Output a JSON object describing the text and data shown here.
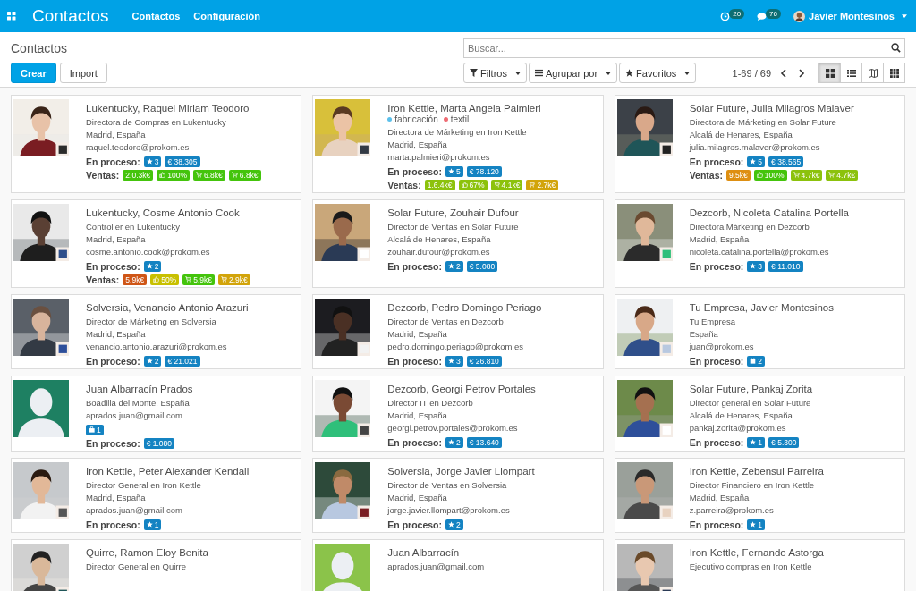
{
  "top_bar": {
    "app_title": "Contactos",
    "menu": [
      "Contactos",
      "Configuración"
    ],
    "activity_count": "20",
    "messages_count": "76",
    "user_name": "Javier Montesinos"
  },
  "control_panel": {
    "breadcrumb": "Contactos",
    "search": {
      "placeholder": "Buscar..."
    },
    "create_button": "Crear",
    "import_button": "Import",
    "filters": [
      {
        "kind": "filter",
        "label": "Filtros"
      },
      {
        "kind": "group",
        "label": "Agrupar por"
      },
      {
        "kind": "favorites",
        "label": "Favoritos"
      }
    ],
    "pager": "1-69 / 69",
    "views": [
      {
        "kind": "kanban",
        "selected": true
      },
      {
        "kind": "list",
        "selected": false
      },
      {
        "kind": "map",
        "selected": false
      },
      {
        "kind": "grid",
        "selected": false
      }
    ]
  },
  "cards": [
    {
      "photo": {
        "kind": "picture"
      },
      "name": "Lukentucky, Raquel Miriam Teodoro",
      "lines": [
        "Directora de Compras en Lukentucky",
        "Madrid, España",
        "raquel.teodoro@prokom.es"
      ],
      "pipeline_label": "En proceso:",
      "pipeline": [
        {
          "kind": "rating",
          "text": "3"
        },
        {
          "kind": "amount",
          "text": "€ 38.305"
        }
      ],
      "sales_label": "Ventas:",
      "sales": [
        {
          "kind": "total",
          "text": "2.0.3k€",
          "color": "#44c40c"
        },
        {
          "kind": "win_rate",
          "text": "100%",
          "color": "#44c40c"
        },
        {
          "kind": "orders",
          "text": "6.8k€",
          "color": "#44c40c"
        },
        {
          "kind": "orders",
          "text": "6.8k€",
          "color": "#44c40c"
        }
      ]
    },
    {
      "photo": {
        "kind": "picture"
      },
      "name": "Iron Kettle, Marta Angela Palmieri",
      "tags": [
        {
          "text": "fabricación",
          "color": "#5bc0eb"
        },
        {
          "text": "textil",
          "color": "#ef6b73"
        }
      ],
      "lines": [
        "Directora de Márketing en Iron Kettle",
        "Madrid, España",
        "marta.palmieri@prokom.es"
      ],
      "pipeline_label": "En proceso:",
      "pipeline": [
        {
          "kind": "rating",
          "text": "5"
        },
        {
          "kind": "amount",
          "text": "€ 78.120"
        }
      ],
      "sales_label": "Ventas:",
      "sales": [
        {
          "kind": "total",
          "text": "1.6.4k€",
          "color": "#8cc20c"
        },
        {
          "kind": "win_rate",
          "text": "67%",
          "color": "#8cc20c"
        },
        {
          "kind": "orders",
          "text": "4.1k€",
          "color": "#8cc20c"
        },
        {
          "kind": "orders",
          "text": "2.7k€",
          "color": "#d2a40a"
        }
      ]
    },
    {
      "photo": {
        "kind": "picture"
      },
      "name": "Solar Future, Julia Milagros Malaver",
      "lines": [
        "Directora de Márketing en Solar Future",
        "Alcalá de Henares, España",
        "julia.milagros.malaver@prokom.es"
      ],
      "pipeline_label": "En proceso:",
      "pipeline": [
        {
          "kind": "rating",
          "text": "5"
        },
        {
          "kind": "amount",
          "text": "€ 38.565"
        }
      ],
      "sales_label": "Ventas:",
      "sales": [
        {
          "kind": "total",
          "text": "9.5k€",
          "color": "#de8f12"
        },
        {
          "kind": "win_rate",
          "text": "100%",
          "color": "#44c40c"
        },
        {
          "kind": "orders",
          "text": "4.7k€",
          "color": "#8cc20c"
        },
        {
          "kind": "orders",
          "text": "4.7k€",
          "color": "#8cc20c"
        }
      ]
    },
    {
      "photo": {
        "kind": "picture"
      },
      "name": "Lukentucky, Cosme Antonio Cook",
      "lines": [
        "Controller en Lukentucky",
        "Madrid, España",
        "cosme.antonio.cook@prokom.es"
      ],
      "pipeline_label": "En proceso:",
      "pipeline": [
        {
          "kind": "rating",
          "text": "2"
        }
      ],
      "sales_label": "Ventas:",
      "sales": [
        {
          "kind": "total",
          "text": "5.9k€",
          "color": "#cf5516"
        },
        {
          "kind": "win_rate",
          "text": "50%",
          "color": "#c8c000"
        },
        {
          "kind": "orders",
          "text": "5.9k€",
          "color": "#44c40c"
        },
        {
          "kind": "orders",
          "text": "2.9k€",
          "color": "#d2a40a"
        }
      ]
    },
    {
      "photo": {
        "kind": "picture"
      },
      "name": "Solar Future, Zouhair Dufour",
      "lines": [
        "Director de Ventas en Solar Future",
        "Alcalá de Henares, España",
        "zouhair.dufour@prokom.es"
      ],
      "pipeline_label": "En proceso:",
      "pipeline": [
        {
          "kind": "rating",
          "text": "2"
        },
        {
          "kind": "amount",
          "text": "€ 5.080"
        }
      ]
    },
    {
      "photo": {
        "kind": "picture"
      },
      "name": "Dezcorb, Nicoleta Catalina Portella",
      "lines": [
        "Directora Márketing en Dezcorb",
        "Madrid, España",
        "nicoleta.catalina.portella@prokom.es"
      ],
      "pipeline_label": "En proceso:",
      "pipeline": [
        {
          "kind": "rating",
          "text": "3"
        },
        {
          "kind": "amount",
          "text": "€ 11.010"
        }
      ]
    },
    {
      "photo": {
        "kind": "picture"
      },
      "name": "Solversia, Venancio Antonio Arazuri",
      "lines": [
        "Director de Márketing en Solversia",
        "Madrid, España",
        "venancio.antonio.arazuri@prokom.es"
      ],
      "pipeline_label": "En proceso:",
      "pipeline": [
        {
          "kind": "rating",
          "text": "2"
        },
        {
          "kind": "amount",
          "text": "€ 21.021"
        }
      ]
    },
    {
      "photo": {
        "kind": "picture"
      },
      "name": "Dezcorb, Pedro Domingo Periago",
      "lines": [
        "Director de Ventas en Dezcorb",
        "Madrid, España",
        "pedro.domingo.periago@prokom.es"
      ],
      "pipeline_label": "En proceso:",
      "pipeline": [
        {
          "kind": "rating",
          "text": "3"
        },
        {
          "kind": "amount",
          "text": "€ 26.810"
        }
      ]
    },
    {
      "photo": {
        "kind": "picture"
      },
      "name": "Tu Empresa, Javier Montesinos",
      "lines": [
        "Tu Empresa",
        "España",
        "juan@prokom.es"
      ],
      "pipeline_label": "En proceso:",
      "pipeline": [
        {
          "kind": "meetings",
          "text": "2"
        }
      ]
    },
    {
      "photo": {
        "kind": "placeholder",
        "color": "#1e8062"
      },
      "name": "Juan Albarracín Prados",
      "lines": [
        "Boadilla del Monte, España",
        "aprados.juan@gmail.com"
      ],
      "extra": [
        {
          "kind": "opportunities",
          "text": "1"
        }
      ],
      "pipeline_label": "En proceso:",
      "pipeline": [
        {
          "kind": "amount",
          "text": "€ 1.080"
        }
      ]
    },
    {
      "photo": {
        "kind": "picture"
      },
      "name": "Dezcorb, Georgi Petrov Portales",
      "lines": [
        "Director IT en Dezcorb",
        "Madrid, España",
        "georgi.petrov.portales@prokom.es"
      ],
      "pipeline_label": "En proceso:",
      "pipeline": [
        {
          "kind": "rating",
          "text": "2"
        },
        {
          "kind": "amount",
          "text": "€ 13.640"
        }
      ]
    },
    {
      "photo": {
        "kind": "picture"
      },
      "name": "Solar Future, Pankaj Zorita",
      "lines": [
        "Director general en Solar Future",
        "Alcalá de Henares, España",
        "pankaj.zorita@prokom.es"
      ],
      "pipeline_label": "En proceso:",
      "pipeline": [
        {
          "kind": "rating",
          "text": "1"
        },
        {
          "kind": "amount",
          "text": "€ 5.300"
        }
      ]
    },
    {
      "photo": {
        "kind": "picture"
      },
      "name": "Iron Kettle, Peter Alexander Kendall",
      "lines": [
        "Director General en Iron Kettle",
        "Madrid, España",
        "aprados.juan@gmail.com"
      ],
      "pipeline_label": "En proceso:",
      "pipeline": [
        {
          "kind": "rating",
          "text": "1"
        }
      ]
    },
    {
      "photo": {
        "kind": "picture"
      },
      "name": "Solversia, Jorge Javier Llompart",
      "lines": [
        "Director de Ventas en Solversia",
        "Madrid, España",
        "jorge.javier.llompart@prokom.es"
      ],
      "pipeline_label": "En proceso:",
      "pipeline": [
        {
          "kind": "rating",
          "text": "2"
        }
      ]
    },
    {
      "photo": {
        "kind": "picture"
      },
      "name": "Iron Kettle, Zebensui Parreira",
      "lines": [
        "Director Financiero en Iron Kettle",
        "Madrid, España",
        "z.parreira@prokom.es"
      ],
      "pipeline_label": "En proceso:",
      "pipeline": [
        {
          "kind": "rating",
          "text": "1"
        }
      ]
    },
    {
      "photo": {
        "kind": "picture"
      },
      "name": "Quirre, Ramon Eloy Benita",
      "lines": [
        "Director General en Quirre"
      ]
    },
    {
      "photo": {
        "kind": "placeholder",
        "color": "#8bc34a"
      },
      "name": "Juan Albarracín",
      "lines": [
        "aprados.juan@gmail.com"
      ]
    },
    {
      "photo": {
        "kind": "picture"
      },
      "name": "Iron Kettle, Fernando Astorga",
      "lines": [
        "Ejecutivo compras en Iron Kettle"
      ]
    }
  ]
}
